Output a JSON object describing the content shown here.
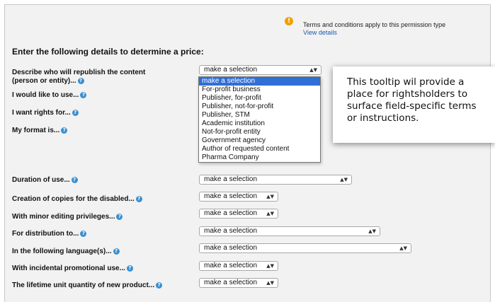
{
  "notice": {
    "icon": "warning-icon",
    "icon_glyph": "!",
    "text": "Terms and conditions apply to this permission type",
    "link": "View details",
    "color": "#f0a000"
  },
  "form": {
    "heading": "Enter the following details to determine a price:",
    "help_glyph": "?",
    "fields": [
      {
        "label_line1": "Describe who will republish the content",
        "label_line2": "(person or entity)...",
        "value": "make a selection"
      },
      {
        "label": "I would like to use..."
      },
      {
        "label": "I want rights for..."
      },
      {
        "label": "My format is..."
      },
      {
        "label": "Duration of use...",
        "value": "make a selection"
      },
      {
        "label": "Creation of copies for the disabled...",
        "value": "make a selection"
      },
      {
        "label": "With minor editing privileges...",
        "value": "make a selection"
      },
      {
        "label": "For distribution to...",
        "value": "make a selection"
      },
      {
        "label": "In the following language(s)...",
        "value": "make a selection"
      },
      {
        "label": "With incidental promotional use...",
        "value": "make a selection"
      },
      {
        "label": "The lifetime unit quantity of new product...",
        "value": "make a selection"
      }
    ]
  },
  "dropdown": {
    "options": [
      "make a selection",
      "For-profit business",
      "Publisher, for-profit",
      "Publisher, not-for-profit",
      "Publisher, STM",
      "Academic institution",
      "Not-for-profit entity",
      "Government agency",
      "Author of requested content",
      "Pharma Company"
    ],
    "selected_index": 0,
    "highlight_color": "#2f6fd6"
  },
  "tooltip": {
    "text": "This tooltip wil provide a place for rightsholders to surface field-specific terms or instructions."
  }
}
